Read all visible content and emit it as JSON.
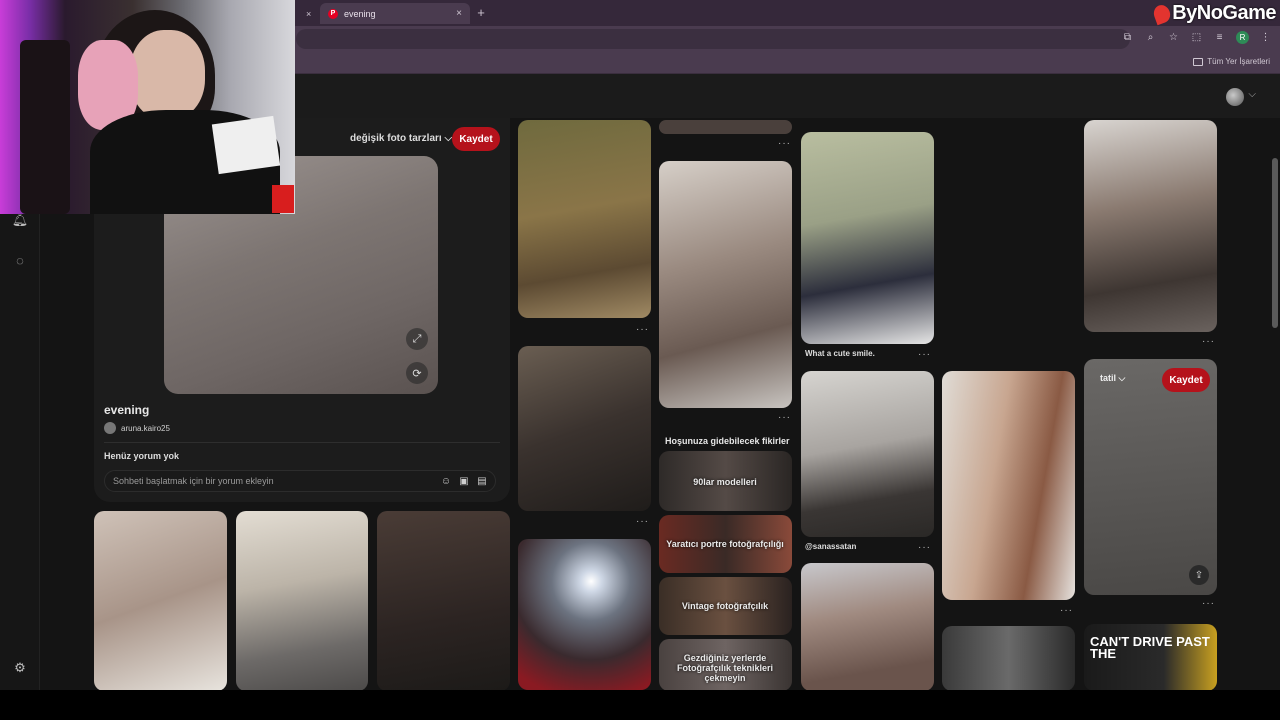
{
  "browser": {
    "tabs": [
      {
        "title": "",
        "close": "×"
      },
      {
        "title": "evening",
        "close": "×",
        "favicon": "P"
      }
    ],
    "new_tab": "+",
    "bookmarks_label": "Tüm Yer İşaretleri",
    "profile_initial": "R"
  },
  "watermark": "ByNoGame",
  "colors": {
    "accent": "#b5121b",
    "background": "#141414"
  },
  "closeup": {
    "board_select": "değişik foto tarzları ⌵",
    "save_label": "Kaydet",
    "title": "evening",
    "author": "aruna.kairo25",
    "no_comments": "Henüz yorum yok",
    "comment_placeholder": "Sohbeti başlatmak için bir yorum ekleyin"
  },
  "feed": {
    "caption_cute": "What a cute smile.",
    "caption_user": "@sanassatan",
    "ideas_heading": "Hoşunuza gidebilecek fikirler",
    "ideas": [
      "90lar modelleri",
      "Yaratıcı portre fotoğrafçılığı",
      "Vintage fotoğrafçılık",
      "Gezdiğiniz yerlerde Fotoğrafçılık teknikleri çekmeyin"
    ],
    "hover_board": "tatil ⌵",
    "hover_save": "Kaydet",
    "cant_text": "CAN'T DRIVE PAST THE",
    "dots": "···"
  }
}
